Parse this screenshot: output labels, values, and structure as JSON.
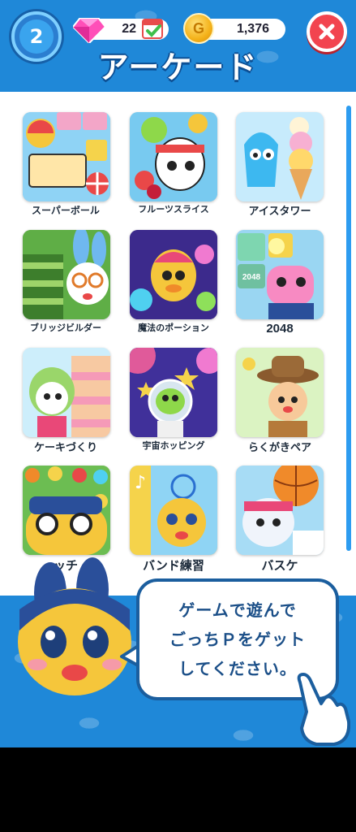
{
  "header": {
    "level": "2",
    "gems": "22",
    "coins": "1,376",
    "coin_symbol": "G",
    "title": "アーケード"
  },
  "games": [
    {
      "label": "スーパーボール",
      "icon": "super-ball-art"
    },
    {
      "label": "フルーツスライス",
      "icon": "fruit-slice-art"
    },
    {
      "label": "アイスタワー",
      "icon": "ice-tower-art"
    },
    {
      "label": "ブリッジビルダー",
      "icon": "bridge-builder-art"
    },
    {
      "label": "魔法のポーション",
      "icon": "magic-potion-art"
    },
    {
      "label": "2048",
      "icon": "game-2048-art"
    },
    {
      "label": "ケーキづくり",
      "icon": "cake-making-art"
    },
    {
      "label": "宇宙ホッピング",
      "icon": "space-hopping-art"
    },
    {
      "label": "らくがきペア",
      "icon": "doodle-pair-art"
    },
    {
      "label": "ッチ",
      "icon": "match-art"
    },
    {
      "label": "バンド練習",
      "icon": "band-practice-art"
    },
    {
      "label": "バスケ",
      "icon": "basketball-art"
    }
  ],
  "tile_art_text": {
    "tile_2048": "2048"
  },
  "speech": {
    "line1": "ゲームで遊んで",
    "line2": "ごっちＰをゲット",
    "line3": "してください。"
  },
  "colors": {
    "background": "#1f88d8",
    "close": "#f2444f",
    "scroll": "#2d9cf0"
  }
}
